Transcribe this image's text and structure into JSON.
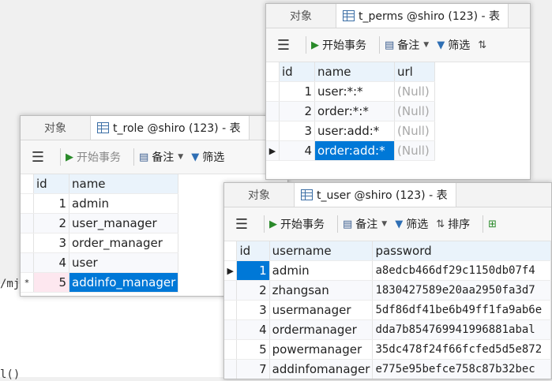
{
  "background": {
    "code_line_1": "/mj",
    "code_line_2": "l()"
  },
  "role_window": {
    "tab_objects": "对象",
    "tab_title": "t_role @shiro (123) - 表",
    "toolbar": {
      "begin": "开始事务",
      "note": "备注",
      "filter": "筛选"
    },
    "columns": [
      "id",
      "name"
    ],
    "rows": [
      {
        "id": "1",
        "name": "admin"
      },
      {
        "id": "2",
        "name": "user_manager"
      },
      {
        "id": "3",
        "name": "order_manager"
      },
      {
        "id": "4",
        "name": "user"
      },
      {
        "id": "5",
        "name": "addinfo_manager",
        "marker": "*"
      }
    ]
  },
  "perms_window": {
    "tab_objects": "对象",
    "tab_title": "t_perms @shiro (123) - 表",
    "toolbar": {
      "begin": "开始事务",
      "note": "备注",
      "filter": "筛选"
    },
    "columns": [
      "id",
      "name",
      "url"
    ],
    "rows": [
      {
        "id": "1",
        "name": "user:*:*",
        "url": "(Null)"
      },
      {
        "id": "2",
        "name": "order:*:*",
        "url": "(Null)"
      },
      {
        "id": "3",
        "name": "user:add:*",
        "url": "(Null)"
      },
      {
        "id": "4",
        "name": "order:add:*",
        "url": "(Null)",
        "marker": "▶"
      }
    ]
  },
  "user_window": {
    "tab_objects": "对象",
    "tab_title": "t_user @shiro (123) - 表",
    "toolbar": {
      "begin": "开始事务",
      "note": "备注",
      "filter": "筛选",
      "sort": "排序"
    },
    "columns": [
      "id",
      "username",
      "password"
    ],
    "rows": [
      {
        "id": "1",
        "username": "admin",
        "password": "a8edcb466df29c1150db07f4",
        "marker": "▶"
      },
      {
        "id": "2",
        "username": "zhangsan",
        "password": "1830427589e20aa2950fa3d7"
      },
      {
        "id": "3",
        "username": "usermanager",
        "password": "5df86df41be6b49ff1fa9ab6e"
      },
      {
        "id": "4",
        "username": "ordermanager",
        "password": "dda7b854769941996881abal"
      },
      {
        "id": "5",
        "username": "powermanager",
        "password": "35dc478f24f66fcfed5d5e872"
      },
      {
        "id": "7",
        "username": "addinfomanager",
        "password": "e775e95befce758c87b32bec"
      }
    ]
  }
}
